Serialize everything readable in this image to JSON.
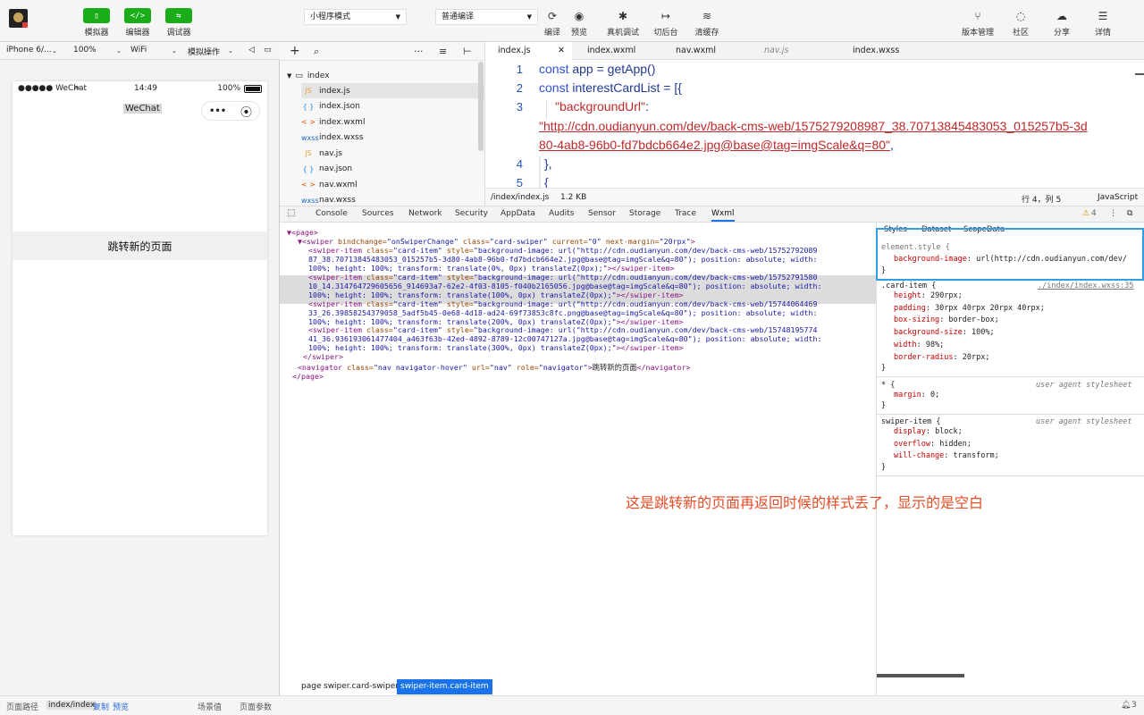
{
  "toolbar": {
    "simulator": "模拟器",
    "editor": "编辑器",
    "debugger": "调试器",
    "mode_select": "小程序模式",
    "compile_select": "普通编译",
    "compile": "编译",
    "preview": "预览",
    "real_device": "真机调试",
    "background": "切后台",
    "clear_cache": "清缓存",
    "version": "版本管理",
    "community": "社区",
    "share": "分享",
    "details": "详情"
  },
  "device_bar": {
    "device": "iPhone 6/...",
    "zoom": "100%",
    "network": "WiFi",
    "simulate": "模拟操作"
  },
  "phone": {
    "carrier": "●●●●● WeChat",
    "time": "14:49",
    "battery": "100%",
    "title": "WeChat",
    "nav_button": "跳转新的页面"
  },
  "file_tree": {
    "folder": "index",
    "files": [
      {
        "icon": "JS",
        "name": "index.js",
        "color": "#e6a23c"
      },
      {
        "icon": "{ }",
        "name": "index.json",
        "color": "#1e88e5"
      },
      {
        "icon": "< >",
        "name": "index.wxml",
        "color": "#e65100"
      },
      {
        "icon": "wxss",
        "name": "index.wxss",
        "color": "#1565c0"
      },
      {
        "icon": "JS",
        "name": "nav.js",
        "color": "#e6a23c"
      },
      {
        "icon": "{ }",
        "name": "nav.json",
        "color": "#1e88e5"
      },
      {
        "icon": "< >",
        "name": "nav.wxml",
        "color": "#e65100"
      },
      {
        "icon": "wxss",
        "name": "nav.wxss",
        "color": "#1565c0"
      }
    ]
  },
  "editor": {
    "tabs": [
      "index.js",
      "index.wxml",
      "nav.wxml",
      "nav.js",
      "index.wxss"
    ],
    "line_numbers": [
      "1",
      "2",
      "3",
      "4",
      "5"
    ],
    "code": {
      "l1_kw": "const",
      "l1_rest": " app = getApp()",
      "l2_kw": "const",
      "l2_rest": " interestCardList = [{",
      "l3_key": "\"backgroundUrl\"",
      "l3_colon": ":",
      "l3b_url": "\"http://cdn.oudianyun.com/dev/back-cms-web/1575279208987_38.70713845483053_015257b5-3d",
      "l3c_url": "80-4ab8-96b0-fd7bdcb664e2.jpg@base@tag=imgScale&q=80\"",
      "l3c_comma": ",",
      "l4": "},",
      "l5": "{"
    },
    "status": {
      "path": "/index/index.js",
      "size": "1.2 KB",
      "position": "行 4，列 5",
      "language": "JavaScript"
    }
  },
  "devtools": {
    "tabs": [
      "Console",
      "Sources",
      "Network",
      "Security",
      "AppData",
      "Audits",
      "Sensor",
      "Storage",
      "Trace",
      "Wxml"
    ],
    "warning_count": "4"
  },
  "wxml": {
    "lines": [
      {
        "parts": [
          [
            "tg",
            "▼<page>"
          ]
        ]
      },
      {
        "parts": [
          [
            "tg",
            "▼<swiper "
          ],
          [
            "an",
            "bindchange="
          ],
          [
            "av",
            "\"onSwiperChange\" "
          ],
          [
            "an",
            "class="
          ],
          [
            "av",
            "\"card-swiper\" "
          ],
          [
            "an",
            "current="
          ],
          [
            "av",
            "\"0\" "
          ],
          [
            "an",
            "next-margin="
          ],
          [
            "av",
            "\"20rpx\""
          ],
          [
            "tg",
            ">"
          ]
        ]
      },
      {
        "parts": [
          [
            "tg",
            "<swiper-item "
          ],
          [
            "an",
            "class="
          ],
          [
            "av",
            "\"card-item\" "
          ],
          [
            "an",
            "style="
          ],
          [
            "av",
            "\"background-image: url(\"http://cdn.oudianyun.com/dev/back-cms-web/15752792089"
          ]
        ]
      },
      {
        "parts": [
          [
            "av",
            "87_38.70713845483053_015257b5-3d80-4ab8-96b0-fd7bdcb664e2.jpg@base@tag=imgScale&q=80\"); position: absolute; width:"
          ]
        ]
      },
      {
        "parts": [
          [
            "av",
            "100%; height: 100%; transform: translate(0%, 0px) translateZ(0px);\""
          ],
          [
            "tg",
            "></swiper-item>"
          ]
        ]
      },
      {
        "parts": [
          [
            "tg",
            "<swiper-item "
          ],
          [
            "an",
            "class="
          ],
          [
            "av",
            "\"card-item\" "
          ],
          [
            "an",
            "style="
          ],
          [
            "av",
            "\"background-image: url(\"http://cdn.oudianyun.com/dev/back-cms-web/15752791580"
          ]
        ]
      },
      {
        "parts": [
          [
            "av",
            "10_14.314764729605656_914693a7-62e2-4f03-8105-f040b2165056.jpg@base@tag=imgScale&q=80\"); position: absolute; width:"
          ]
        ]
      },
      {
        "parts": [
          [
            "av",
            "100%; height: 100%; transform: translate(100%, 0px) translateZ(0px);\""
          ],
          [
            "tg",
            "></swiper-item>"
          ]
        ]
      },
      {
        "parts": [
          [
            "tg",
            "<swiper-item "
          ],
          [
            "an",
            "class="
          ],
          [
            "av",
            "\"card-item\" "
          ],
          [
            "an",
            "style="
          ],
          [
            "av",
            "\"background-image: url(\"http://cdn.oudianyun.com/dev/back-cms-web/15744064469"
          ]
        ]
      },
      {
        "parts": [
          [
            "av",
            "33_26.39858254379058_5adf5b45-0e68-4d18-ad24-69f73853c8fc.png@base@tag=imgScale&q=80\"); position: absolute; width:"
          ]
        ]
      },
      {
        "parts": [
          [
            "av",
            "100%; height: 100%; transform: translate(200%, 0px) translateZ(0px);\""
          ],
          [
            "tg",
            "></swiper-item>"
          ]
        ]
      },
      {
        "parts": [
          [
            "tg",
            "<swiper-item "
          ],
          [
            "an",
            "class="
          ],
          [
            "av",
            "\"card-item\" "
          ],
          [
            "an",
            "style="
          ],
          [
            "av",
            "\"background-image: url(\"http://cdn.oudianyun.com/dev/back-cms-web/15748195774"
          ]
        ]
      },
      {
        "parts": [
          [
            "av",
            "41_36.936193061477404_a463f63b-42ed-4892-8789-12c00747127a.jpg@base@tag=imgScale&q=80\"); position: absolute; width:"
          ]
        ]
      },
      {
        "parts": [
          [
            "av",
            "100%; height: 100%; transform: translate(300%, 0px) translateZ(0px);\""
          ],
          [
            "tg",
            "></swiper-item>"
          ]
        ]
      },
      {
        "parts": [
          [
            "tg",
            "</swiper>"
          ]
        ]
      },
      {
        "parts": [
          [
            "tg",
            "<navigator "
          ],
          [
            "an",
            "class="
          ],
          [
            "av",
            "\"nav navigator-hover\" "
          ],
          [
            "an",
            "url="
          ],
          [
            "av",
            "\"nav\" "
          ],
          [
            "an",
            "role="
          ],
          [
            "av",
            "\"navigator\""
          ],
          [
            "tg",
            ">"
          ],
          [
            "tx",
            "跳转新的页面"
          ],
          [
            "tg",
            "</navigator>"
          ]
        ]
      },
      {
        "parts": [
          [
            "tg",
            "</page>"
          ]
        ]
      }
    ],
    "breadcrumbs": [
      "page",
      "swiper.card-swiper",
      "swiper-item.card-item"
    ]
  },
  "styles": {
    "tabs": [
      "Styles",
      "Dataset",
      "ScopeData"
    ],
    "element_style_selector": "element.style {",
    "element_style_prop": "background-image",
    "element_style_val": ": url(http://cdn.oudianyun.com/dev/",
    "close_brace": "}",
    "card_item_selector": ".card-item {",
    "card_item_source": "./index/index.wxss:35",
    "card_item_props": [
      {
        "name": "height",
        "value": ": 290rpx;"
      },
      {
        "name": "padding",
        "value": ": 30rpx 40rpx 20rpx 40rpx;"
      },
      {
        "name": "box-sizing",
        "value": ": border-box;"
      },
      {
        "name": "background-size",
        "value": ": 100%;"
      },
      {
        "name": "width",
        "value": ": 98%;"
      },
      {
        "name": "border-radius",
        "value": ": 20rpx;"
      }
    ],
    "star_selector": "* {",
    "star_source": "user agent stylesheet",
    "star_props": [
      {
        "name": "margin",
        "value": ": 0;"
      }
    ],
    "swiper_selector": "swiper-item {",
    "swiper_source": "user agent stylesheet",
    "swiper_props": [
      {
        "name": "display",
        "value": ": block;"
      },
      {
        "name": "overflow",
        "value": ": hidden;"
      },
      {
        "name": "will-change",
        "value": ": transform;"
      }
    ]
  },
  "annotation": "这是跳转新的页面再返回时候的样式丢了，显示的是空白",
  "bottom_bar": {
    "page_path_label": "页面路径",
    "page_path": "index/index",
    "copy": "复制",
    "preview": "预览",
    "scene": "场景值",
    "params": "页面参数",
    "notifications": "3"
  },
  "colors": {
    "accent_green": "#1aad19",
    "highlight_blue": "#2ea0e6",
    "annotation_red": "#e44d26"
  }
}
